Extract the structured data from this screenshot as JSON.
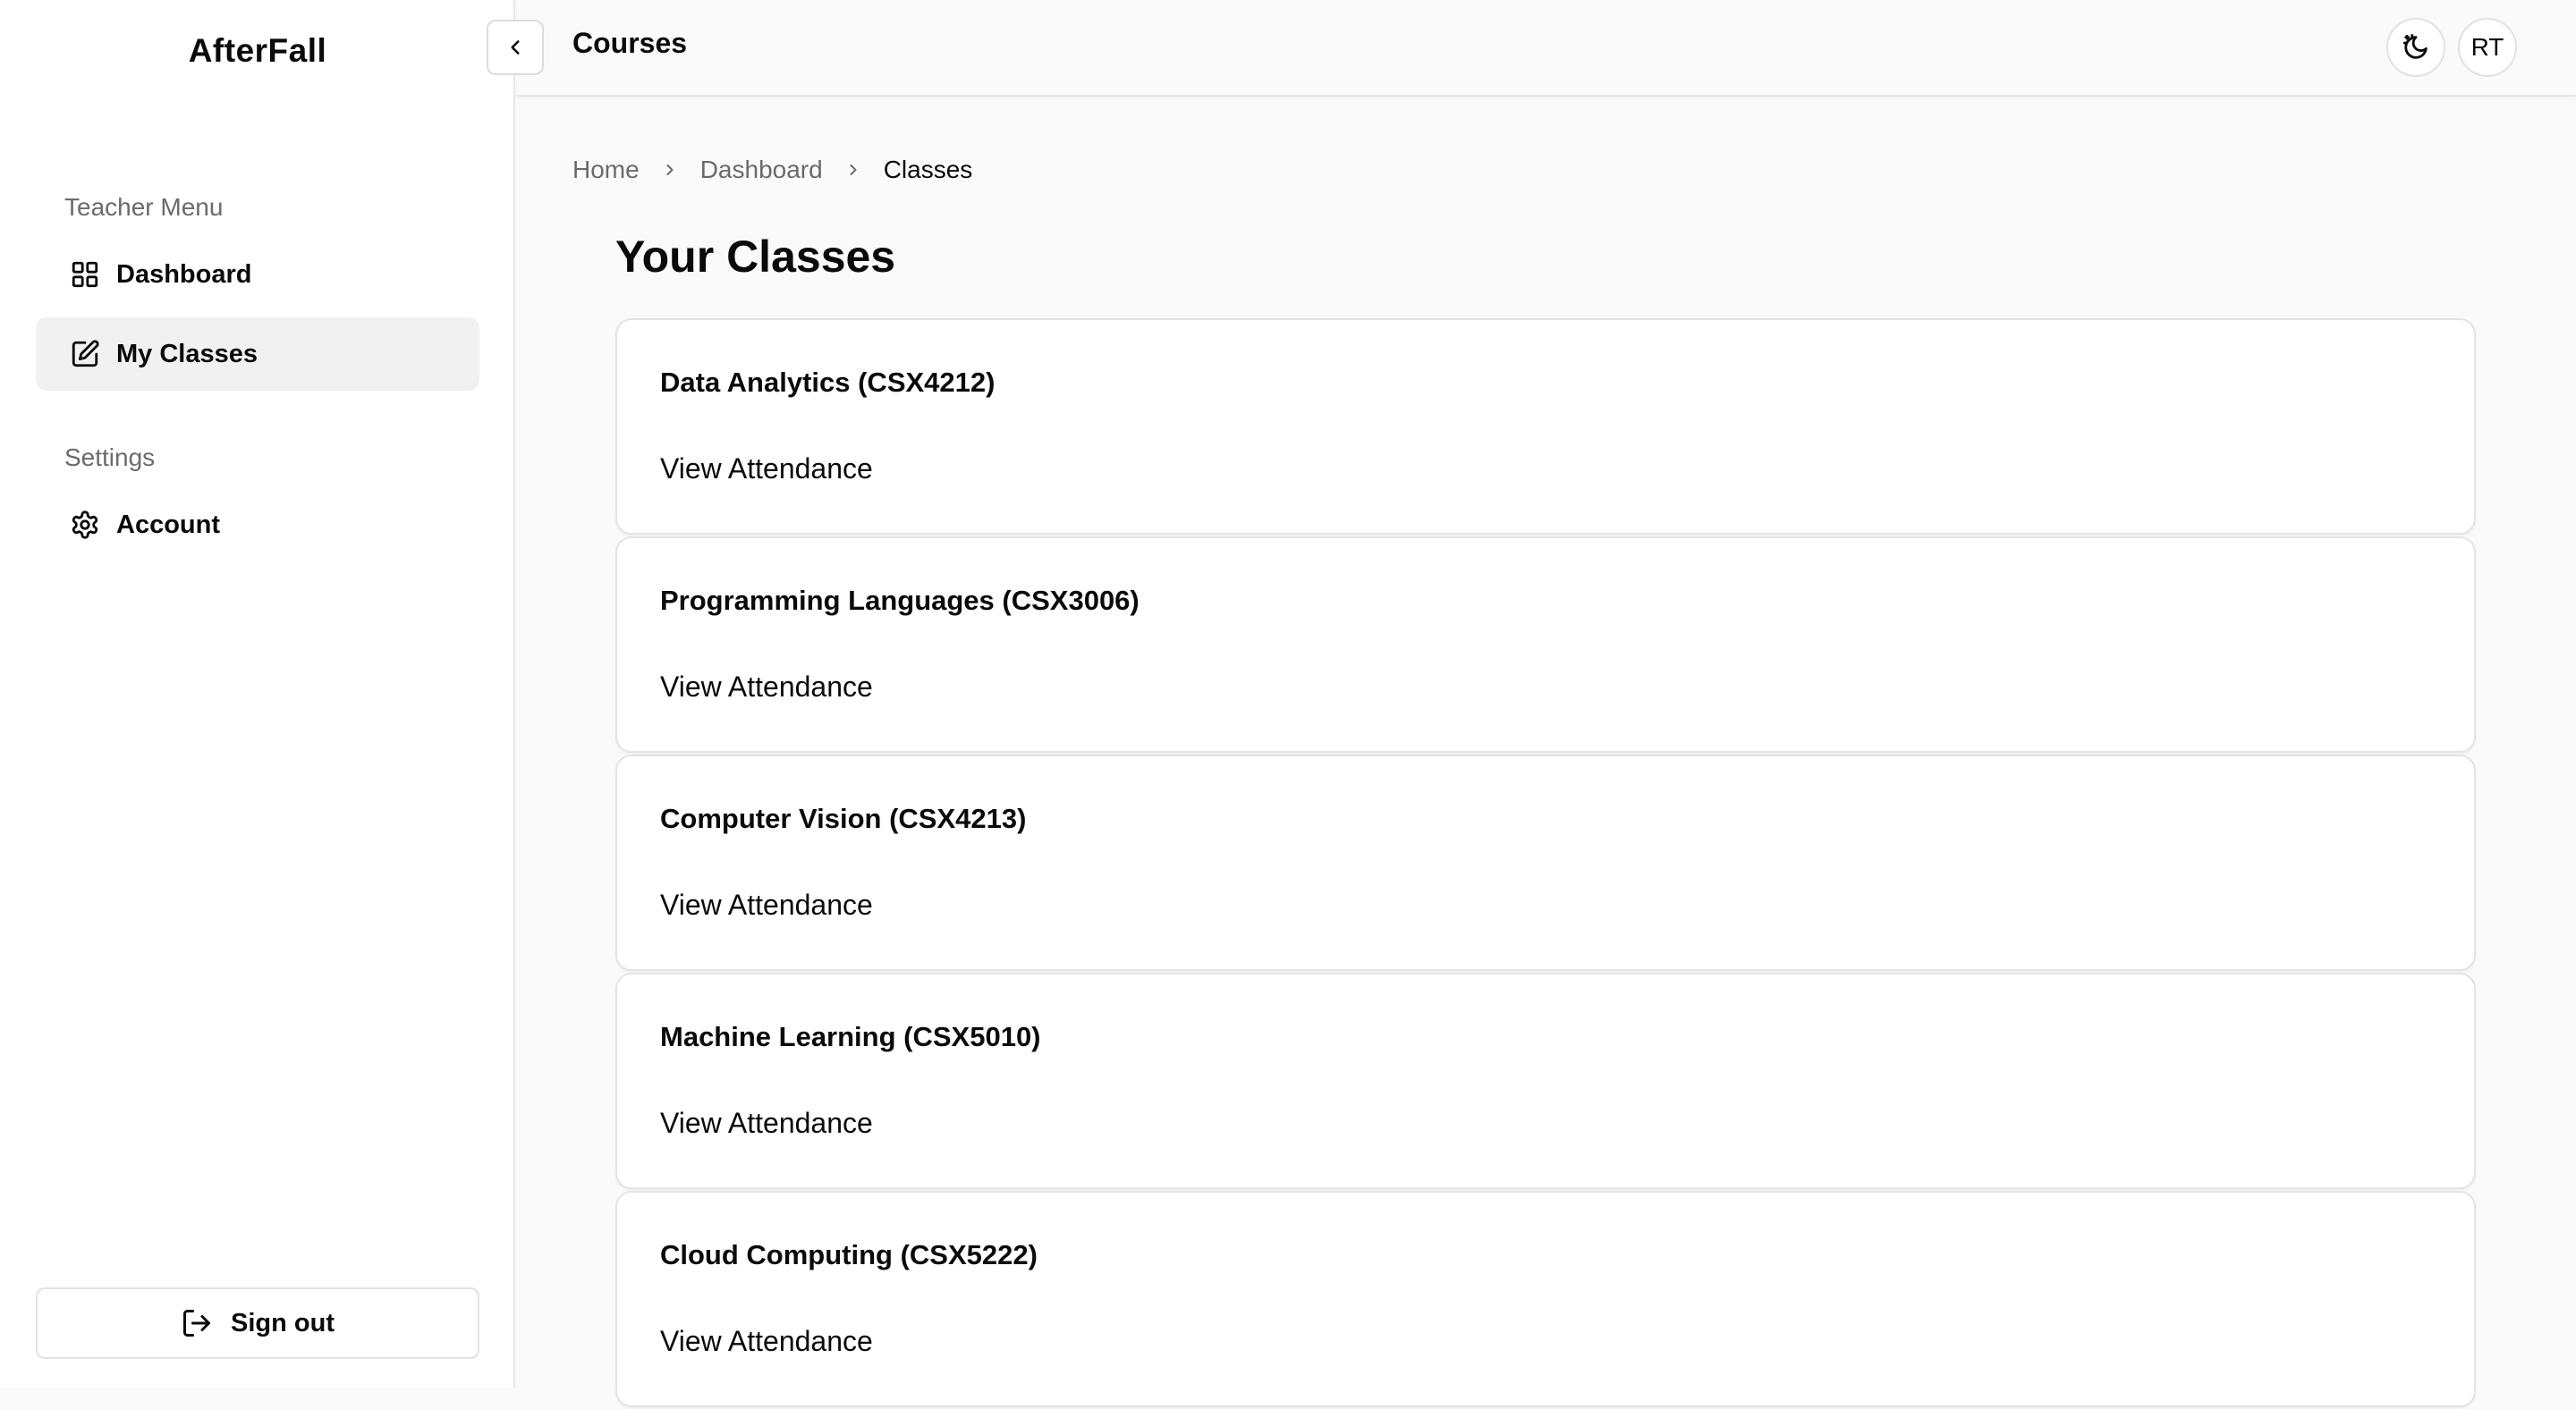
{
  "sidebar": {
    "brand": "AfterFall",
    "teacher_menu_label": "Teacher Menu",
    "items": [
      {
        "label": "Dashboard",
        "icon": "grid-icon"
      },
      {
        "label": "My Classes",
        "icon": "edit-icon"
      }
    ],
    "settings_label": "Settings",
    "settings_items": [
      {
        "label": "Account",
        "icon": "gear-icon"
      }
    ],
    "signout_label": "Sign out"
  },
  "header": {
    "title": "Courses",
    "avatar_initials": "RT"
  },
  "breadcrumb": [
    "Home",
    "Dashboard",
    "Classes"
  ],
  "main": {
    "title": "Your Classes",
    "view_label": "View Attendance",
    "courses": [
      {
        "name": "Data Analytics (CSX4212)"
      },
      {
        "name": "Programming Languages (CSX3006)"
      },
      {
        "name": "Computer Vision (CSX4213)"
      },
      {
        "name": "Machine Learning (CSX5010)"
      },
      {
        "name": "Cloud Computing (CSX5222)"
      }
    ]
  },
  "colors": {
    "background": "#fafafa",
    "sidebar": "#ffffff",
    "active_item": "#f1f1f1",
    "muted_text": "#6b6b6b",
    "border": "#e4e4e4"
  }
}
